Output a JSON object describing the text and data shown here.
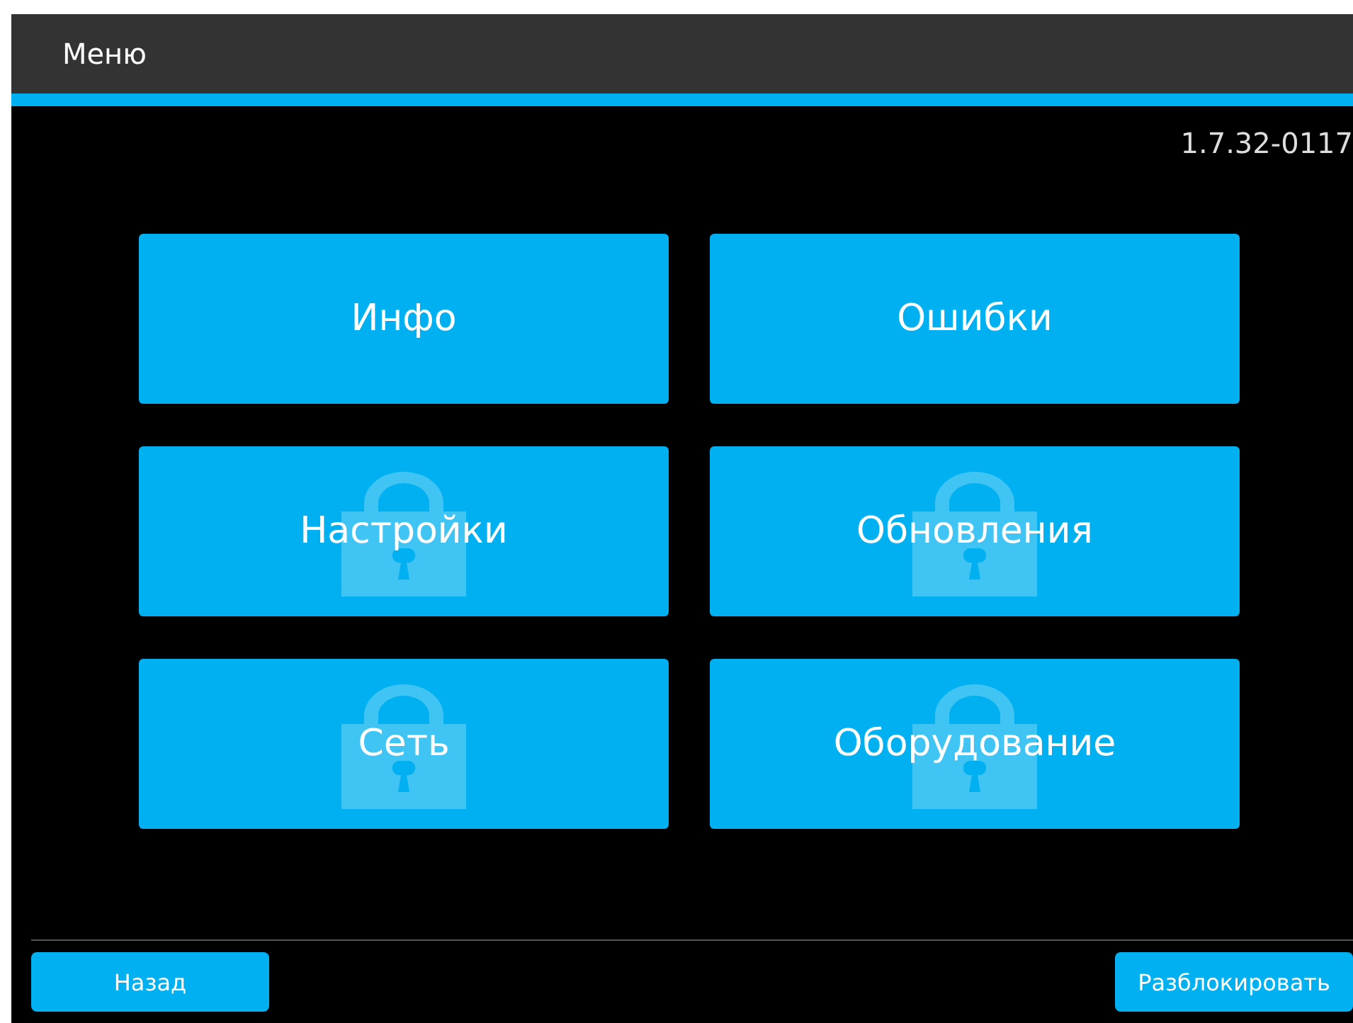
{
  "header": {
    "title": "Меню"
  },
  "version": "1.7.32-0117",
  "tiles": [
    {
      "label": "Инфо",
      "locked": false
    },
    {
      "label": "Ошибки",
      "locked": false
    },
    {
      "label": "Настройки",
      "locked": true
    },
    {
      "label": "Обновления",
      "locked": true
    },
    {
      "label": "Сеть",
      "locked": true
    },
    {
      "label": "Оборудование",
      "locked": true
    }
  ],
  "footer": {
    "back": "Назад",
    "unlock": "Разблокировать"
  }
}
